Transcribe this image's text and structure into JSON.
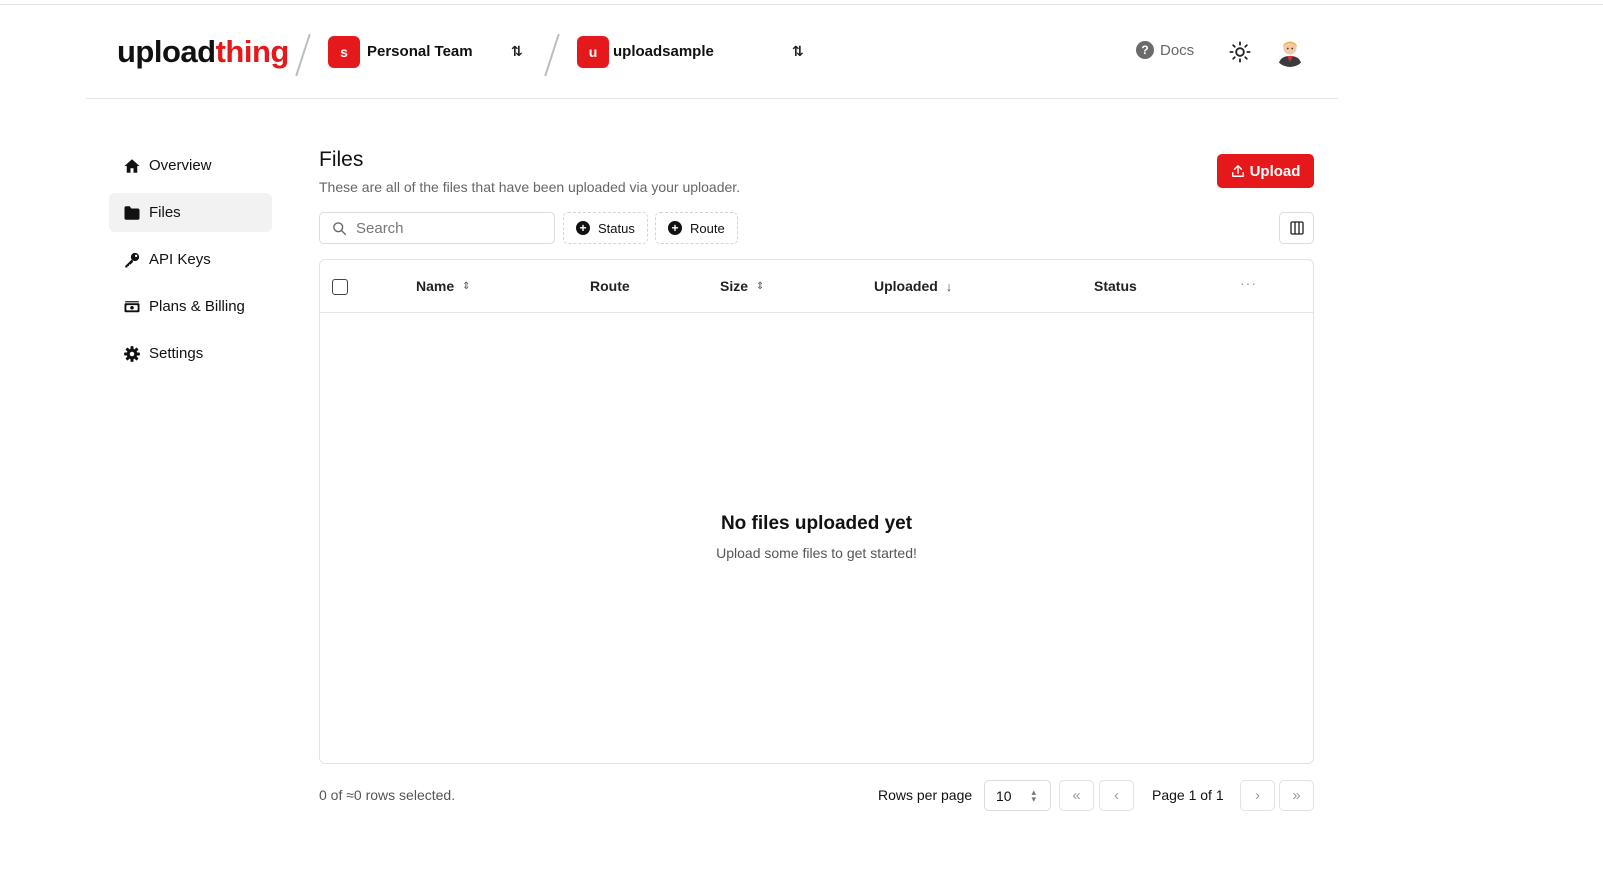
{
  "header": {
    "logo_part1": "upload",
    "logo_part2": "thing",
    "team": {
      "badge": "s",
      "name": "Personal Team"
    },
    "app": {
      "badge": "u",
      "name": "uploadsample"
    },
    "docs_label": "Docs",
    "brand_color": "#e5191b"
  },
  "sidebar": {
    "items": [
      {
        "label": "Overview",
        "icon": "home-icon",
        "active": false
      },
      {
        "label": "Files",
        "icon": "folder-icon",
        "active": true
      },
      {
        "label": "API Keys",
        "icon": "key-icon",
        "active": false
      },
      {
        "label": "Plans & Billing",
        "icon": "money-icon",
        "active": false
      },
      {
        "label": "Settings",
        "icon": "gear-icon",
        "active": false
      }
    ]
  },
  "main": {
    "title": "Files",
    "subtitle": "These are all of the files that have been uploaded via your uploader.",
    "upload_label": "Upload",
    "search_placeholder": "Search",
    "filters": [
      "Status",
      "Route"
    ],
    "table": {
      "columns": [
        "Name",
        "Route",
        "Size",
        "Uploaded",
        "Status"
      ],
      "empty_title": "No files uploaded yet",
      "empty_subtitle": "Upload some files to get started!"
    },
    "footer": {
      "selection": "0 of ≈0 rows selected.",
      "rows_per_page_label": "Rows per page",
      "rows_per_page_value": "10",
      "page_label": "Page 1 of 1"
    }
  }
}
